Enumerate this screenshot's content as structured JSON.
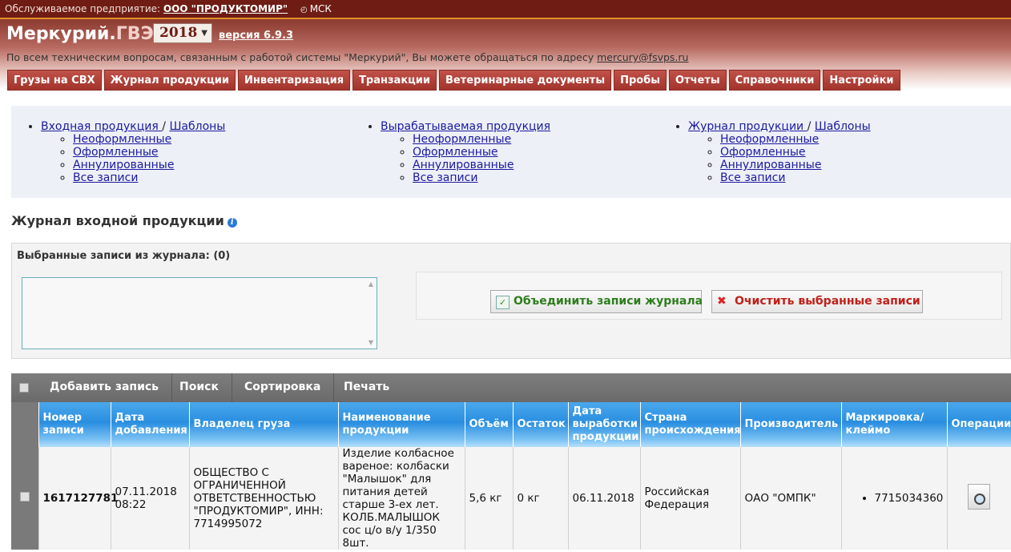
{
  "topbar": {
    "enterprise_label": "Обслуживаемое предприятие:",
    "enterprise_name": "ООО \"ПРОДУКТОМИР\"",
    "timezone": "МСК"
  },
  "header": {
    "logo_main": "Меркурий.",
    "logo_suffix": "ГВЭ",
    "year": "2018",
    "version": "версия 6.9.3",
    "support_text": "По всем техническим вопросам, связанным с работой системы \"Меркурий\", Вы можете обращаться по адресу",
    "support_email": "mercury@fsvps.ru"
  },
  "nav": [
    "Грузы на СВХ",
    "Журнал продукции",
    "Инвентаризация",
    "Транзакции",
    "Ветеринарные документы",
    "Пробы",
    "Отчеты",
    "Справочники",
    "Настройки"
  ],
  "links": {
    "col1": {
      "main": "Входная продукция ",
      "extra": "Шаблоны",
      "items": [
        "Неоформленные",
        "Оформленные",
        "Аннулированные",
        "Все записи"
      ]
    },
    "col2": {
      "main": "Вырабатываемая продукция",
      "items": [
        "Неоформленные",
        "Оформленные",
        "Аннулированные",
        "Все записи"
      ]
    },
    "col3": {
      "main": "Журнал продукции ",
      "extra": "Шаблоны",
      "items": [
        "Неоформленные",
        "Оформленные",
        "Аннулированные",
        "Все записи"
      ]
    }
  },
  "section": {
    "title": "Журнал входной продукции",
    "selected_label": "Выбранные записи из журнала: (0)",
    "merge_button": "Объединить записи журнала",
    "clear_button": "Очистить выбранные записи"
  },
  "toolbar": [
    "Добавить запись",
    "Поиск",
    "Сортировка",
    "Печать"
  ],
  "table": {
    "headers": [
      "Номер записи",
      "Дата добавления",
      "Владелец груза",
      "Наименование продукции",
      "Объём",
      "Остаток",
      "Дата выработки продукции",
      "Страна происхождения",
      "Производитель",
      "Маркировка/ клеймо",
      "Операции"
    ],
    "rows": [
      {
        "number": "1617127781",
        "date_added": "07.11.2018 08:22",
        "owner": "ОБЩЕСТВО С ОГРАНИЧЕННОЙ ОТВЕТСТВЕННОСТЬЮ \"ПРОДУКТОМИР\", ИНН: 7714995072",
        "product": "Изделие колбасное вареное: колбаски \"Малышок\" для питания детей старше 3-ех лет. КОЛБ.МАЛЫШОК сос ц/о в/у 1/350 8шт.",
        "volume": "5,6 кг",
        "remainder": "0 кг",
        "production_date": "06.11.2018",
        "country": "Российская Федерация",
        "producer": "ОАО \"ОМПК\"",
        "marking": "7715034360",
        "operation_icon": "view-document-icon"
      }
    ]
  },
  "colors": {
    "topbar": "#6e1c14",
    "nav_button": "#a2342c",
    "table_header": "#2a8ee0",
    "merge_text": "#2e7d1e",
    "clear_text": "#c0201a"
  }
}
